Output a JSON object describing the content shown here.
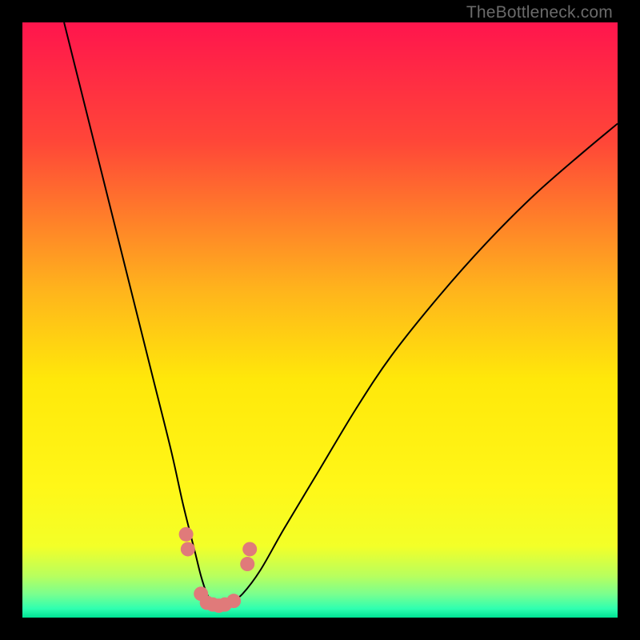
{
  "watermark": "TheBottleneck.com",
  "chart_data": {
    "type": "line",
    "title": "",
    "xlabel": "",
    "ylabel": "",
    "xlim": [
      0,
      100
    ],
    "ylim": [
      0,
      100
    ],
    "grid": false,
    "legend": false,
    "background_gradient": {
      "stops": [
        {
          "pos": 0.0,
          "color": "#ff154d"
        },
        {
          "pos": 0.2,
          "color": "#ff4638"
        },
        {
          "pos": 0.45,
          "color": "#ffb41c"
        },
        {
          "pos": 0.6,
          "color": "#ffe80a"
        },
        {
          "pos": 0.78,
          "color": "#fff718"
        },
        {
          "pos": 0.88,
          "color": "#f3ff28"
        },
        {
          "pos": 0.93,
          "color": "#b8ff5e"
        },
        {
          "pos": 0.96,
          "color": "#7bff8e"
        },
        {
          "pos": 0.985,
          "color": "#2fffb0"
        },
        {
          "pos": 1.0,
          "color": "#00e293"
        }
      ]
    },
    "series": [
      {
        "name": "bottleneck-curve",
        "color": "#000000",
        "x": [
          7,
          10,
          13,
          16,
          19,
          22,
          25,
          27,
          29,
          30,
          31,
          32,
          33,
          34,
          35,
          37,
          40,
          44,
          50,
          56,
          62,
          70,
          78,
          86,
          94,
          100
        ],
        "y": [
          100,
          88,
          76,
          64,
          52,
          40,
          28,
          19,
          11,
          7,
          4,
          2.5,
          2,
          2,
          2.5,
          4,
          8,
          15,
          25,
          35,
          44,
          54,
          63,
          71,
          78,
          83
        ]
      }
    ],
    "markers": {
      "name": "highlight-points",
      "color": "#e07a7a",
      "x": [
        27.5,
        27.8,
        30.0,
        31.0,
        32.0,
        33.0,
        34.0,
        35.5,
        37.8,
        38.2
      ],
      "y": [
        14.0,
        11.5,
        4.0,
        2.5,
        2.2,
        2.0,
        2.2,
        2.8,
        9.0,
        11.5
      ]
    }
  }
}
